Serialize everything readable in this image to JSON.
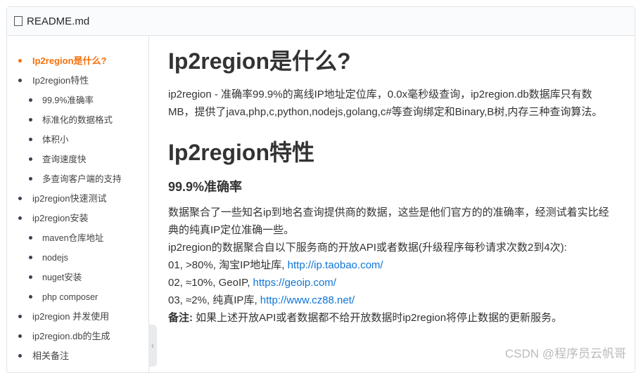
{
  "header": {
    "filename": "README.md"
  },
  "toc": [
    {
      "label": "Ip2region是什么?",
      "level": 1,
      "active": true
    },
    {
      "label": "Ip2region特性",
      "level": 1
    },
    {
      "label": "99.9%准确率",
      "level": 2
    },
    {
      "label": "标准化的数据格式",
      "level": 2
    },
    {
      "label": "体积小",
      "level": 2
    },
    {
      "label": "查询速度快",
      "level": 2
    },
    {
      "label": "多查询客户端的支持",
      "level": 2
    },
    {
      "label": "ip2region快速测试",
      "level": 1
    },
    {
      "label": "ip2region安装",
      "level": 1
    },
    {
      "label": "maven仓库地址",
      "level": 2
    },
    {
      "label": "nodejs",
      "level": 2
    },
    {
      "label": "nuget安装",
      "level": 2
    },
    {
      "label": "php composer",
      "level": 2
    },
    {
      "label": "ip2region 并发使用",
      "level": 1
    },
    {
      "label": "ip2region.db的生成",
      "level": 1
    },
    {
      "label": "相关备注",
      "level": 1
    }
  ],
  "content": {
    "h1a": "Ip2region是什么?",
    "intro": "ip2region - 准确率99.9%的离线IP地址定位库，0.0x毫秒级查询，ip2region.db数据库只有数MB，提供了java,php,c,python,nodejs,golang,c#等查询绑定和Binary,B树,内存三种查询算法。",
    "h1b": "Ip2region特性",
    "h3": "99.9%准确率",
    "p1": "数据聚合了一些知名ip到地名查询提供商的数据，这些是他们官方的的准确率，经测试着实比经典的纯真IP定位准确一些。",
    "p2": "ip2region的数据聚合自以下服务商的开放API或者数据(升级程序每秒请求次数2到4次):",
    "l1": "01, >80%, 淘宝IP地址库, ",
    "l1url": "http://ip.taobao.com/",
    "l2": "02, ≈10%, GeoIP, ",
    "l2url": "https://geoip.com/",
    "l3": "03, ≈2%, 纯真IP库, ",
    "l3url": "http://www.cz88.net/",
    "note_label": "备注:",
    "note": " 如果上述开放API或者数据都不给开放数据时ip2region将停止数据的更新服务。"
  },
  "watermark": "CSDN @程序员云帆哥"
}
